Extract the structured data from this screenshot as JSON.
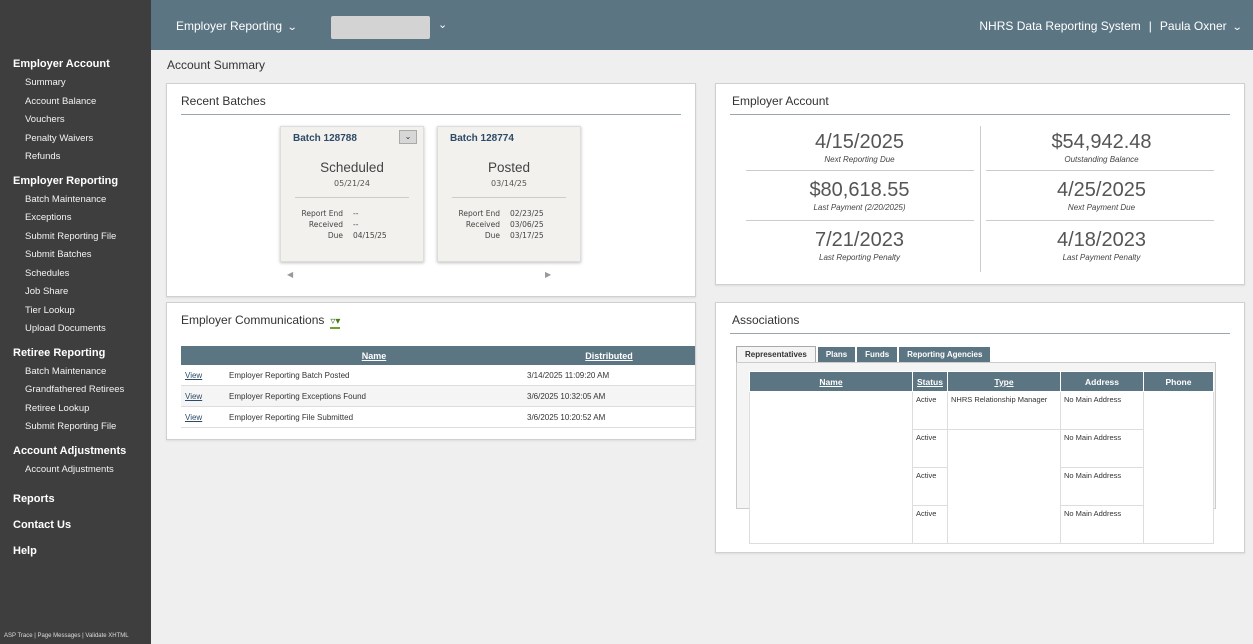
{
  "topbar": {
    "menu_label": "Employer Reporting",
    "system_name": "NHRS Data Reporting System",
    "separator": "|",
    "user_name": "Paula Oxner"
  },
  "sidebar": {
    "groups": [
      {
        "heading": "Employer Account",
        "items": [
          "Summary",
          "Account Balance",
          "Vouchers",
          "Penalty Waivers",
          "Refunds"
        ]
      },
      {
        "heading": "Employer Reporting",
        "items": [
          "Batch Maintenance",
          "Exceptions",
          "Submit Reporting File",
          "Submit Batches",
          "Schedules",
          "Job Share",
          "Tier Lookup",
          "Upload Documents"
        ]
      },
      {
        "heading": "Retiree Reporting",
        "items": [
          "Batch Maintenance",
          "Grandfathered Retirees",
          "Retiree Lookup",
          "Submit Reporting File"
        ]
      },
      {
        "heading": "Account Adjustments",
        "items": [
          "Account Adjustments"
        ]
      }
    ],
    "singles": [
      "Reports",
      "Contact Us",
      "Help"
    ],
    "footer": "ASP Trace | Page Messages | Validate XHTML"
  },
  "page_title": "Account Summary",
  "recent_batches": {
    "title": "Recent Batches",
    "batches": [
      {
        "name": "Batch 128788",
        "status": "Scheduled",
        "date": "05/21/24",
        "report_end": "--",
        "received": "--",
        "due": "04/15/25"
      },
      {
        "name": "Batch 128774",
        "status": "Posted",
        "date": "03/14/25",
        "report_end": "02/23/25",
        "received": "03/06/25",
        "due": "03/17/25"
      }
    ],
    "labels": {
      "report_end": "Report End",
      "received": "Received",
      "due": "Due"
    }
  },
  "employer_account": {
    "title": "Employer Account",
    "stats": [
      {
        "value": "4/15/2025",
        "label": "Next Reporting Due"
      },
      {
        "value": "$54,942.48",
        "label": "Outstanding Balance"
      },
      {
        "value": "$80,618.55",
        "label": "Last Payment (2/20/2025)"
      },
      {
        "value": "4/25/2025",
        "label": "Next Payment Due"
      },
      {
        "value": "7/21/2023",
        "label": "Last Reporting Penalty"
      },
      {
        "value": "4/18/2023",
        "label": "Last Payment Penalty"
      }
    ]
  },
  "communications": {
    "title": "Employer Communications",
    "columns": [
      "Name",
      "Distributed"
    ],
    "rows": [
      {
        "link": "View",
        "name": "Employer Reporting Batch Posted",
        "distributed": "3/14/2025 11:09:20 AM"
      },
      {
        "link": "View",
        "name": "Employer Reporting Exceptions Found",
        "distributed": "3/6/2025 10:32:05 AM"
      },
      {
        "link": "View",
        "name": "Employer Reporting File Submitted",
        "distributed": "3/6/2025 10:20:52 AM"
      }
    ]
  },
  "associations": {
    "title": "Associations",
    "tabs": [
      "Representatives",
      "Plans",
      "Funds",
      "Reporting Agencies"
    ],
    "columns": [
      "Name",
      "Status",
      "Type",
      "Address",
      "Phone"
    ],
    "rows": [
      {
        "status": "Active",
        "type": "NHRS Relationship Manager",
        "address": "No Main Address"
      },
      {
        "status": "Active",
        "type": "",
        "address": "No Main Address"
      },
      {
        "status": "Active",
        "type": "",
        "address": "No Main Address"
      },
      {
        "status": "Active",
        "type": "",
        "address": "No Main Address"
      }
    ]
  }
}
